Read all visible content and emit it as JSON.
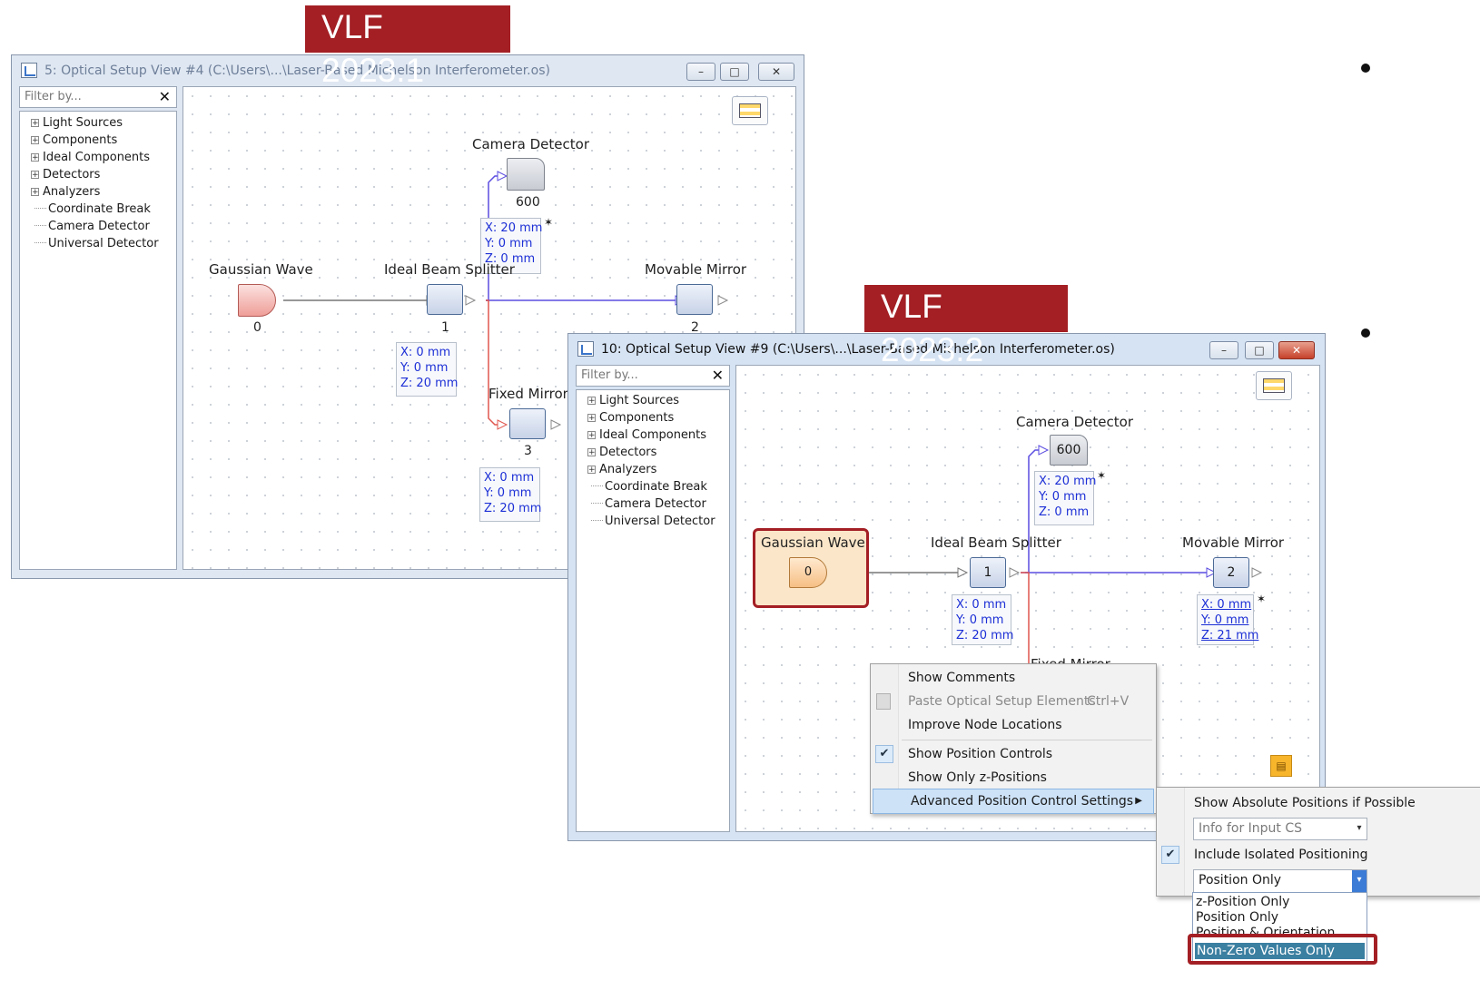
{
  "labels": {
    "v1": "VLF 2023.1",
    "v2": "VLF 2023.2"
  },
  "win1": {
    "title": "5: Optical Setup View #4 (C:\\Users\\...\\Laser-Based Michelson Interferometer.os)",
    "filter_placeholder": "Filter by...",
    "tree": [
      "Light Sources",
      "Components",
      "Ideal Components",
      "Detectors",
      "Analyzers",
      "Coordinate Break",
      "Camera Detector",
      "Universal Detector"
    ],
    "nodes": {
      "gaussian": {
        "label": "Gaussian Wave",
        "num": "0"
      },
      "splitter": {
        "label": "Ideal Beam Splitter",
        "num": "1"
      },
      "movable": {
        "label": "Movable Mirror",
        "num": "2"
      },
      "fixed": {
        "label": "Fixed Mirror",
        "num": "3"
      },
      "camera": {
        "label": "Camera Detector",
        "num": "600"
      }
    },
    "pos_camera": [
      "X: 20 mm",
      "Y: 0 mm",
      "Z: 0 mm"
    ],
    "pos_splitter": [
      "X: 0 mm",
      "Y: 0 mm",
      "Z: 20 mm"
    ],
    "pos_fixed": [
      "X: 0 mm",
      "Y: 0 mm",
      "Z: 20 mm"
    ]
  },
  "win2": {
    "title": "10: Optical Setup View #9 (C:\\Users\\...\\Laser-Based Michelson Interferometer.os)",
    "filter_placeholder": "Filter by...",
    "tree": [
      "Light Sources",
      "Components",
      "Ideal Components",
      "Detectors",
      "Analyzers",
      "Coordinate Break",
      "Camera Detector",
      "Universal Detector"
    ],
    "nodes": {
      "gaussian": {
        "label": "Gaussian Wave",
        "num": "0"
      },
      "splitter": {
        "label": "Ideal Beam Splitter",
        "num": "1"
      },
      "movable": {
        "label": "Movable Mirror",
        "num": "2"
      },
      "fixed": {
        "label": "Fixed Mirror"
      },
      "camera": {
        "label": "Camera Detector",
        "num": "600"
      }
    },
    "pos_camera": [
      "X: 20 mm",
      "Y: 0 mm",
      "Z: 0 mm"
    ],
    "pos_splitter": [
      "X: 0 mm",
      "Y: 0 mm",
      "Z: 20 mm"
    ],
    "pos_movable": [
      "X: 0 mm",
      "Y: 0 mm",
      "Z: 21 mm"
    ]
  },
  "context_menu": {
    "show_comments": "Show Comments",
    "paste": "Paste Optical Setup Elements",
    "paste_shortcut": "Ctrl+V",
    "improve": "Improve Node Locations",
    "show_position_controls": "Show Position Controls",
    "show_z_positions": "Show Only z-Positions",
    "advanced": "Advanced Position Control Settings"
  },
  "submenu": {
    "show_absolute": "Show Absolute Positions if Possible",
    "info_input_cs": "Info for Input CS",
    "include_isolated": "Include Isolated Positioning",
    "selected_mode": "Position Only",
    "options": [
      "z-Position Only",
      "Position Only",
      "Position & Orientation",
      "Non-Zero Values Only"
    ]
  },
  "colors": {
    "accent_red": "#a31f24",
    "beam_blue": "#5b4de0",
    "beam_red": "#e0574f",
    "link_blue": "#1c2fd6"
  }
}
